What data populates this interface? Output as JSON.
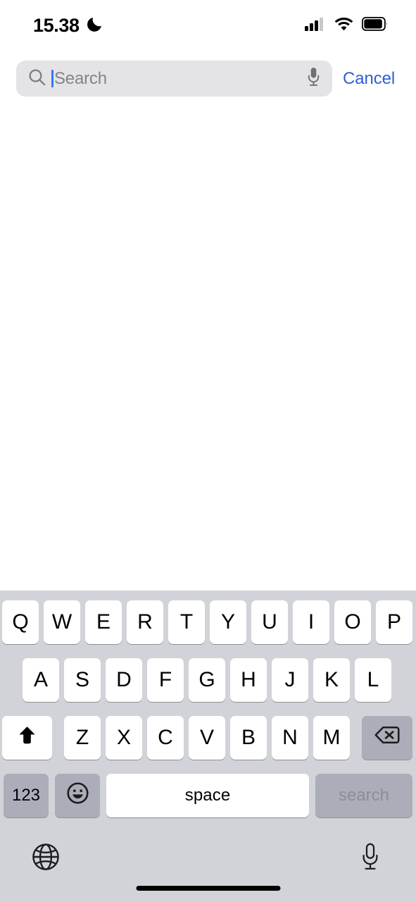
{
  "status_bar": {
    "time": "15.38",
    "focus_icon": "crescent-moon-icon",
    "cellular_icon": "cellular-signal-icon",
    "cellular_bars_filled": 3,
    "cellular_bars_total": 4,
    "wifi_icon": "wifi-icon",
    "battery_icon": "battery-icon",
    "battery_level_percent": 88
  },
  "search": {
    "placeholder": "Search",
    "value": "",
    "search_icon": "search-icon",
    "dictate_icon": "microphone-icon",
    "cancel_label": "Cancel",
    "caret_color": "#3478f6",
    "field_bg": "#e4e4e6",
    "cancel_color": "#2f5fd0"
  },
  "keyboard": {
    "layout": "qwerty",
    "shift_state": "on",
    "background": "#d1d3d9",
    "key_bg": "#ffffff",
    "modifier_key_bg": "#abaeb8",
    "rows": [
      {
        "keys": [
          "Q",
          "W",
          "E",
          "R",
          "T",
          "Y",
          "U",
          "I",
          "O",
          "P"
        ]
      },
      {
        "keys": [
          "A",
          "S",
          "D",
          "F",
          "G",
          "H",
          "J",
          "K",
          "L"
        ]
      },
      {
        "keys": [
          "Z",
          "X",
          "C",
          "V",
          "B",
          "N",
          "M"
        ]
      }
    ],
    "shift_key": {
      "icon": "shift-arrow-icon",
      "label": "shift"
    },
    "backspace_key": {
      "icon": "backspace-icon",
      "label": "delete"
    },
    "numbers_key": {
      "label": "123"
    },
    "emoji_key": {
      "icon": "emoji-smiley-icon",
      "label": "emoji"
    },
    "space_key": {
      "label": "space"
    },
    "return_key": {
      "label": "search",
      "enabled": false
    },
    "globe_key": {
      "icon": "globe-icon",
      "label": "next keyboard"
    },
    "dictation_key": {
      "icon": "microphone-icon",
      "label": "dictation"
    }
  },
  "home_indicator": {
    "visible": true
  }
}
